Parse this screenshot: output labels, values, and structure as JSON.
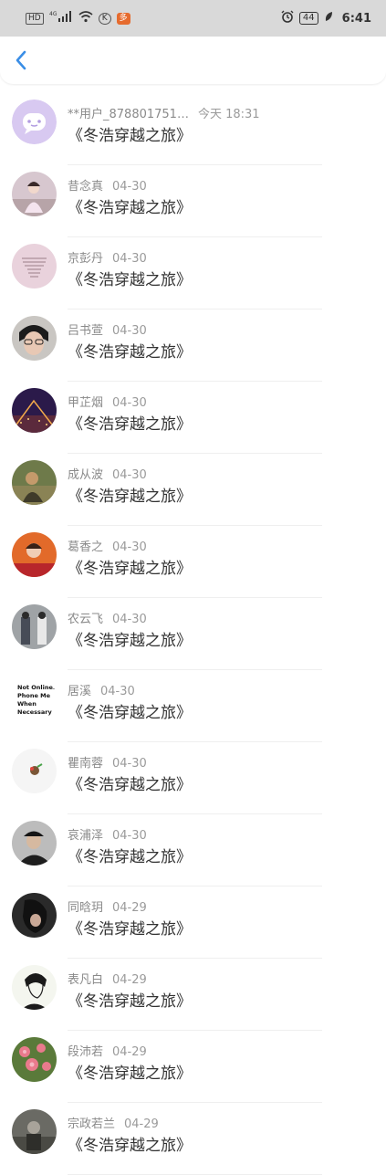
{
  "status_bar": {
    "hd": "HD",
    "signal": "4G",
    "app1": "K",
    "app2": "多",
    "battery": "44",
    "time": "6:41"
  },
  "nav": {
    "back_icon": "chevron-left-icon"
  },
  "colors": {
    "accent": "#3a8ee6",
    "status_bg": "#d9d9d9"
  },
  "items": [
    {
      "user": "**用户_878801751…",
      "date": "今天 18:31",
      "text": "《冬浩穿越之旅》",
      "avatar": "default"
    },
    {
      "user": "昔念真",
      "date": "04-30",
      "text": "《冬浩穿越之旅》",
      "avatar": "photo-pink"
    },
    {
      "user": "京彭丹",
      "date": "04-30",
      "text": "《冬浩穿越之旅》",
      "avatar": "text-pink"
    },
    {
      "user": "吕书萱",
      "date": "04-30",
      "text": "《冬浩穿越之旅》",
      "avatar": "photo-portrait"
    },
    {
      "user": "甲芷烟",
      "date": "04-30",
      "text": "《冬浩穿越之旅》",
      "avatar": "photo-night"
    },
    {
      "user": "成从波",
      "date": "04-30",
      "text": "《冬浩穿越之旅》",
      "avatar": "photo-green"
    },
    {
      "user": "葛香之",
      "date": "04-30",
      "text": "《冬浩穿越之旅》",
      "avatar": "photo-red"
    },
    {
      "user": "农云飞",
      "date": "04-30",
      "text": "《冬浩穿越之旅》",
      "avatar": "photo-couple"
    },
    {
      "user": "居溪",
      "date": "04-30",
      "text": "《冬浩穿越之旅》",
      "avatar": "text-black"
    },
    {
      "user": "瞿南蓉",
      "date": "04-30",
      "text": "《冬浩穿越之旅》",
      "avatar": "sticker"
    },
    {
      "user": "哀浦泽",
      "date": "04-30",
      "text": "《冬浩穿越之旅》",
      "avatar": "photo-cap"
    },
    {
      "user": "同晗玥",
      "date": "04-29",
      "text": "《冬浩穿越之旅》",
      "avatar": "photo-dark"
    },
    {
      "user": "表凡白",
      "date": "04-29",
      "text": "《冬浩穿越之旅》",
      "avatar": "sketch"
    },
    {
      "user": "段沛若",
      "date": "04-29",
      "text": "《冬浩穿越之旅》",
      "avatar": "photo-flowers"
    },
    {
      "user": "宗政若兰",
      "date": "04-29",
      "text": "《冬浩穿越之旅》",
      "avatar": "photo-vintage"
    }
  ],
  "avatar_text": {
    "居溪": [
      "Not Online.",
      "Phone Me",
      "When",
      "Necessary."
    ]
  }
}
